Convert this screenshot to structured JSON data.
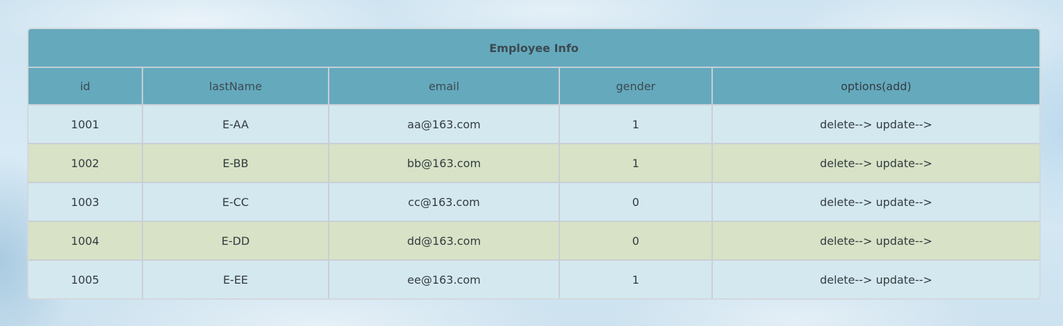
{
  "table": {
    "title": "Employee Info",
    "headers": {
      "id": "id",
      "last_name": "lastName",
      "email": "email",
      "gender": "gender",
      "options": "options(add)"
    },
    "rows": [
      {
        "id": "1001",
        "last_name": "E-AA",
        "email": "aa@163.com",
        "gender": "1",
        "delete": "delete-->",
        "update": "update-->"
      },
      {
        "id": "1002",
        "last_name": "E-BB",
        "email": "bb@163.com",
        "gender": "1",
        "delete": "delete-->",
        "update": "update-->"
      },
      {
        "id": "1003",
        "last_name": "E-CC",
        "email": "cc@163.com",
        "gender": "0",
        "delete": "delete-->",
        "update": "update-->"
      },
      {
        "id": "1004",
        "last_name": "E-DD",
        "email": "dd@163.com",
        "gender": "0",
        "delete": "delete-->",
        "update": "update-->"
      },
      {
        "id": "1005",
        "last_name": "E-EE",
        "email": "ee@163.com",
        "gender": "1",
        "delete": "delete-->",
        "update": "update-->"
      }
    ]
  },
  "colors": {
    "header_bg": "#65a9bd",
    "row_odd_bg": "#d4e8f0",
    "row_even_bg": "#d7e2c6"
  }
}
